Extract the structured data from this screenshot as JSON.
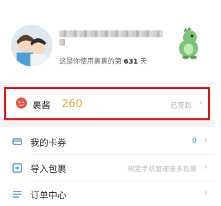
{
  "profile": {
    "days_prefix": "这是你使用裹裹的第",
    "days_count": "631",
    "days_suffix": "天"
  },
  "points": {
    "label": "裹酱",
    "value": "260",
    "status": "已签到"
  },
  "menu": [
    {
      "label": "我的卡券",
      "value": "0"
    },
    {
      "label": "导入包裹",
      "hint": "绑定手机管理更多包裹"
    },
    {
      "label": "订单中心"
    }
  ],
  "colors": {
    "highlight_border": "#e01f1f",
    "points_value": "#e6a23c",
    "icon_blue": "#3d8bd9"
  }
}
